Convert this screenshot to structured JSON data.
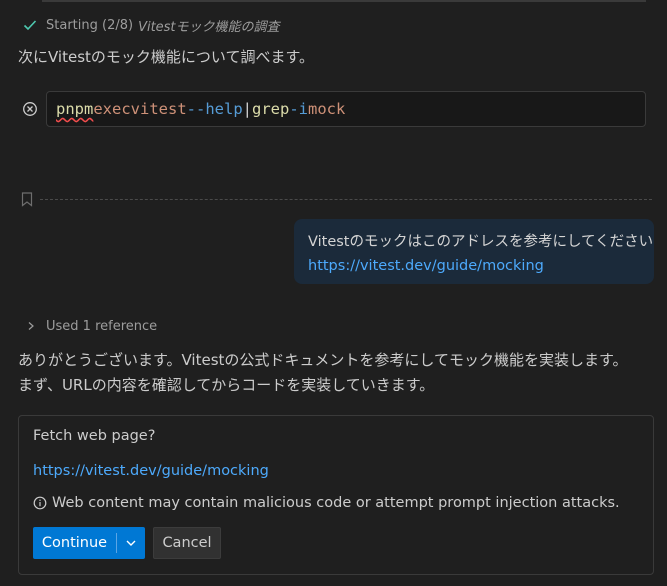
{
  "progress": {
    "status": "Starting (2/8)",
    "task": "Vitestモック機能の調査"
  },
  "intro_text": "次にVitestのモック機能について調べます。",
  "command": {
    "tokens": {
      "cmd": "pnpm",
      "exec": "exec",
      "tool": "vitest",
      "help_flag": "--help",
      "pipe": "|",
      "grep": "grep",
      "i_flag": "-i",
      "pattern": "mock"
    }
  },
  "user_message": {
    "text": "Vitestのモックはこのアドレスを参考にしてください",
    "link": "https://vitest.dev/guide/mocking"
  },
  "references": {
    "label": "Used 1 reference"
  },
  "response": {
    "line1": "ありがとうございます。Vitestの公式ドキュメントを参考にしてモック機能を実装します。",
    "line2": "まず、URLの内容を確認してからコードを実装していきます。"
  },
  "fetch_prompt": {
    "title": "Fetch web page?",
    "url": "https://vitest.dev/guide/mocking",
    "warning": "Web content may contain malicious code or attempt prompt injection attacks.",
    "continue_label": "Continue",
    "cancel_label": "Cancel"
  },
  "colors": {
    "background": "#1f1f1f",
    "accent": "#0078d4",
    "link": "#4daafc",
    "user_bubble": "#1b2a3a"
  },
  "icons": {
    "progress": "check-icon",
    "command_status": "cancelled-circle-icon",
    "checkpoint": "bookmark-icon",
    "references": "chevron-right-icon",
    "warning": "info-icon",
    "dropdown": "chevron-down-icon"
  }
}
